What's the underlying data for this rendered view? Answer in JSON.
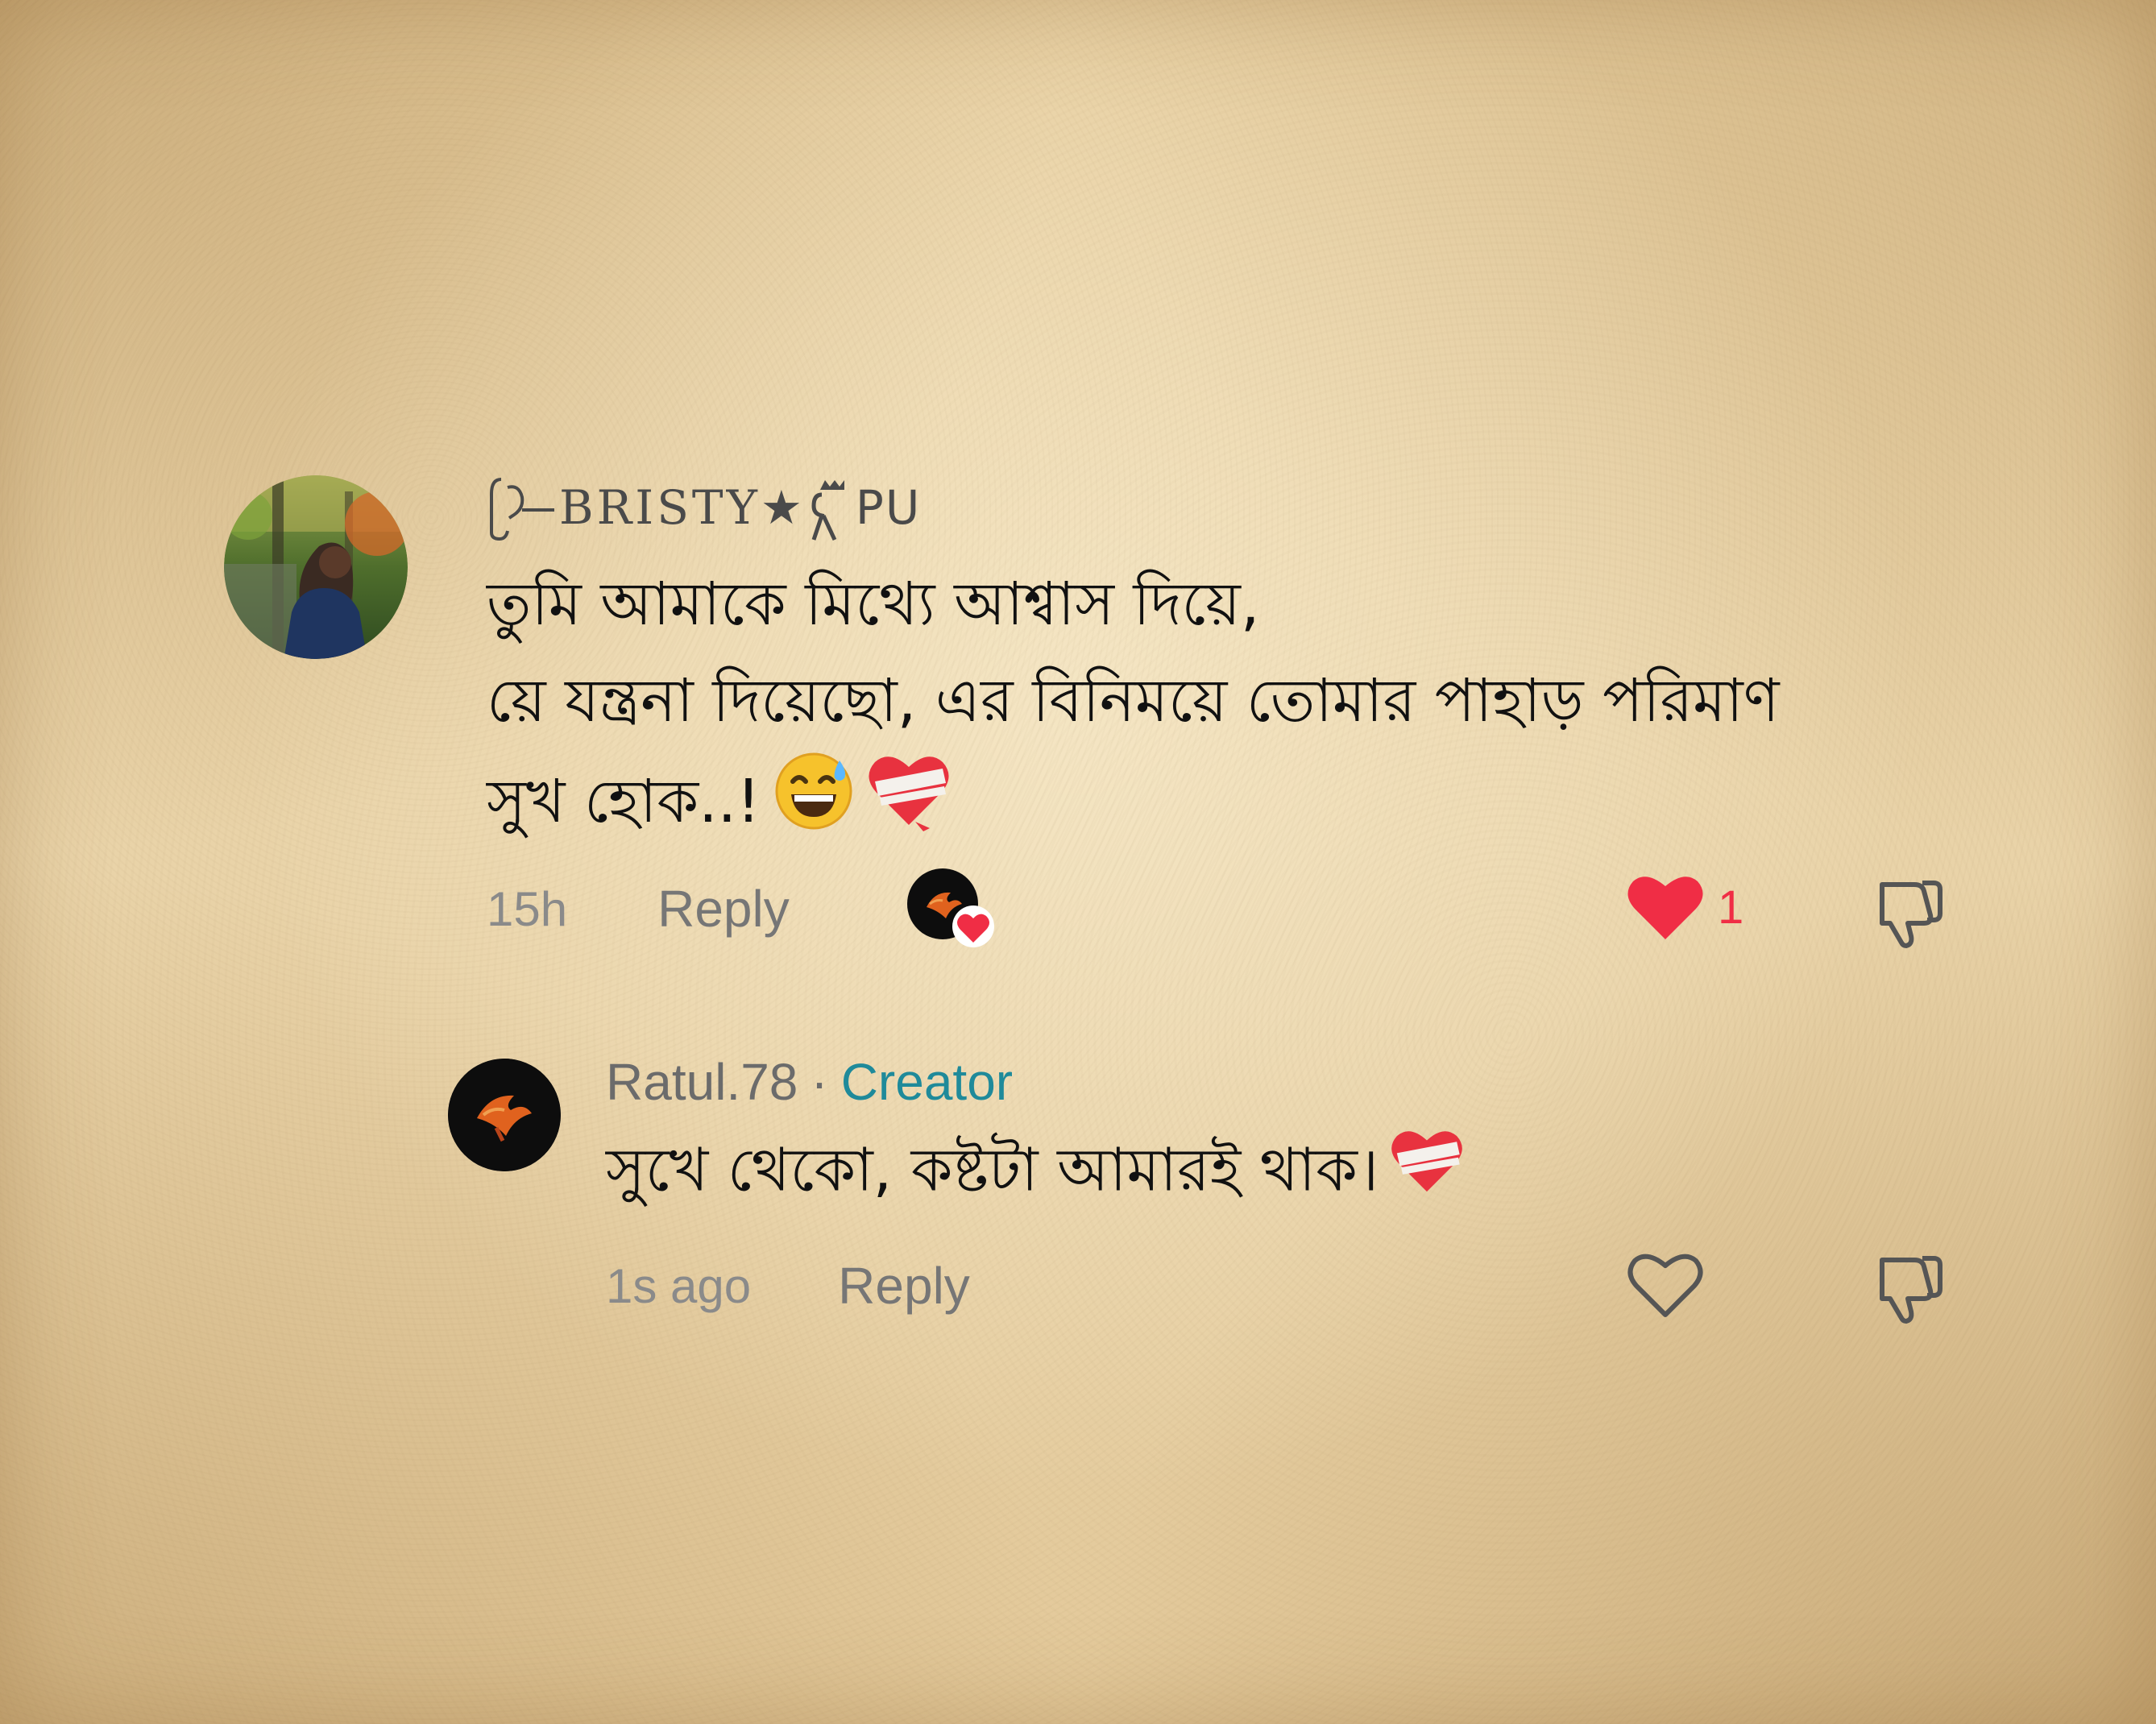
{
  "comment": {
    "username": "BRISTY★",
    "username_suffix": "PU",
    "text_lines": [
      "তুমি আমাকে মিথ্যে আশ্বাস দিয়ে,",
      "য়ে যন্ত্রনা দিয়েছো, এর বিনিময়ে তোমার পাহাড় পরিমাণ",
      "সুখ হোক..!"
    ],
    "emojis": [
      "grinning-face-with-sweat",
      "mending-heart"
    ],
    "time": "15h",
    "reply_label": "Reply",
    "like_count": "1",
    "liked": true,
    "creator_liked": true
  },
  "reply": {
    "username": "Ratul.78",
    "separator": "·",
    "badge": "Creator",
    "text": "সুখে থেকো, কষ্টটা আমারই থাক।",
    "emojis": [
      "mending-heart"
    ],
    "time": "1s ago",
    "reply_label": "Reply",
    "liked": false
  },
  "colors": {
    "like_red": "#f02d45",
    "creator_teal": "#1f8a9a",
    "meta_gray": "#8a8a8a",
    "text_black": "#111111"
  },
  "icons": [
    "heart-filled-icon",
    "heart-outline-icon",
    "thumbs-down-icon",
    "mending-heart-emoji",
    "sweat-smile-emoji"
  ]
}
